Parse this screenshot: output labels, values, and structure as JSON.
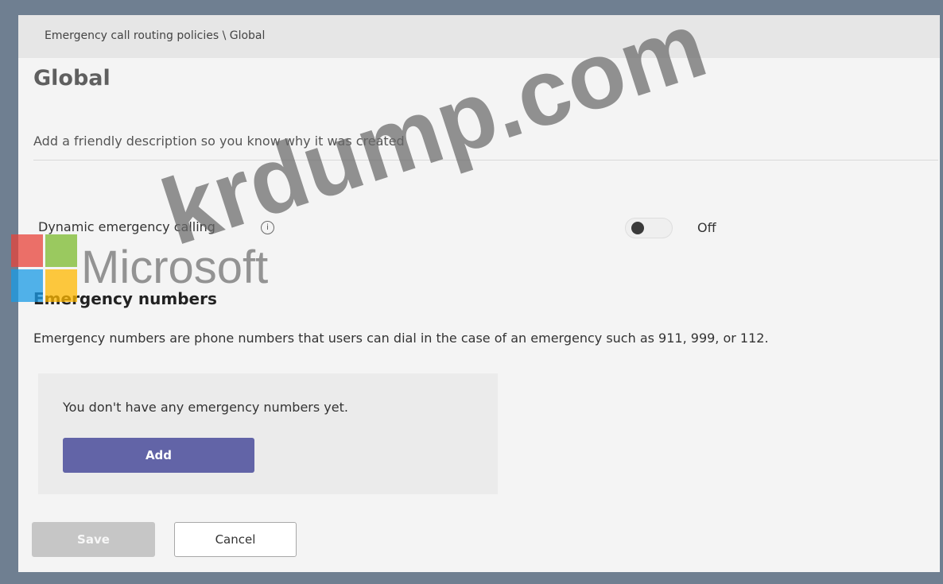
{
  "breadcrumb": "Emergency call routing policies \\ Global",
  "page_title": "Global",
  "description_placeholder": "Add a friendly description so you know why it was created",
  "dynamic_calling": {
    "label": "Dynamic emergency calling",
    "info_icon": "i",
    "toggle_state": "Off"
  },
  "emergency_numbers": {
    "heading": "Emergency numbers",
    "description": "Emergency numbers are phone numbers that users can dial in the case of an emergency such as 911, 999, or 112.",
    "empty_text": "You don't have any emergency numbers yet.",
    "add_label": "Add"
  },
  "footer": {
    "save_label": "Save",
    "cancel_label": "Cancel"
  },
  "watermark": {
    "brand": "Microsoft",
    "site": "krdump.com",
    "logo_colors": [
      "#e8433a",
      "#7cbb2e",
      "#1a9be6",
      "#ffb800"
    ]
  },
  "colors": {
    "accent": "#6264a7",
    "disabled": "#c6c6c6"
  }
}
